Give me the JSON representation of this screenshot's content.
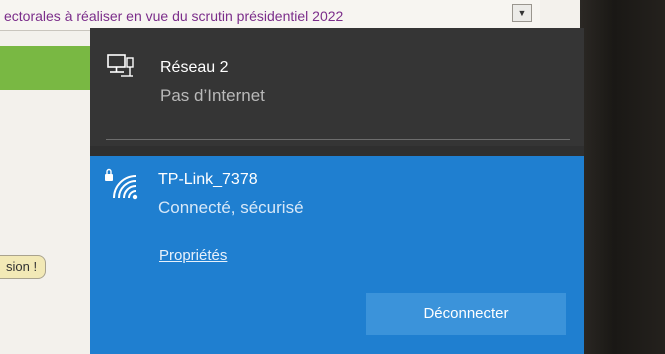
{
  "background_page": {
    "header_text": "ectorales à réaliser en vue du scrutin présidentiel 2022",
    "dropdown_arrow": "▼",
    "button_text": "sion !"
  },
  "network_flyout": {
    "networks": [
      {
        "name": "Réseau 2",
        "status": "Pas d’Internet",
        "icon": "ethernet-computer-icon"
      },
      {
        "name": "TP-Link_7378",
        "status": "Connecté, sécurisé",
        "icon": "wifi-secured-icon",
        "properties_link": "Propriétés",
        "action_button": "Déconnecter"
      }
    ]
  },
  "colors": {
    "flyout_bg": "#353535",
    "selected_network_bg": "#1f7fd0",
    "button_bg": "#3b93da",
    "header_text": "#7b2d8a"
  }
}
